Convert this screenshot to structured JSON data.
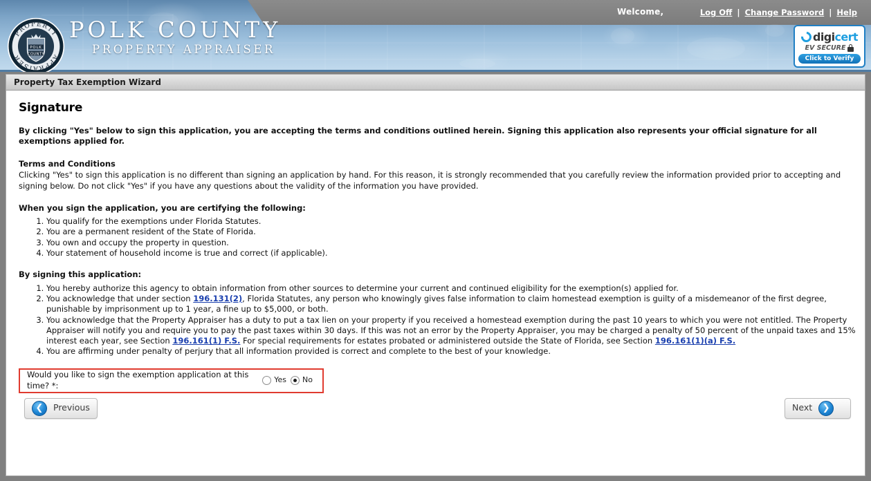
{
  "header": {
    "welcome": "Welcome,",
    "links": [
      {
        "label": "Log Off"
      },
      {
        "label": "Change Password"
      },
      {
        "label": "Help"
      }
    ],
    "separator": "|",
    "logo": {
      "title": "POLK COUNTY",
      "subtitle": "PROPERTY APPRAISER",
      "seal_outer_top": "PROPERTY",
      "seal_outer_bottom": "APPRAISER",
      "seal_shield_line1": "POLK",
      "seal_shield_line2": "COUNTY"
    },
    "digicert": {
      "brand_prefix": "digi",
      "brand_suffix": "cert",
      "tagline": "EV SECURE",
      "verify_label": "Click to Verify"
    }
  },
  "panel": {
    "title": "Property Tax Exemption Wizard"
  },
  "signature": {
    "heading": "Signature",
    "intro": "By clicking \"Yes\" below to sign this application, you are accepting the terms and conditions outlined herein. Signing this application also represents your official signature for all exemptions applied for.",
    "terms_heading": "Terms and Conditions",
    "terms_body": "Clicking \"Yes\" to sign this application is no different than signing an application by hand. For this reason, it is strongly recommended that you carefully review the information provided prior to accepting and signing below. Do not click \"Yes\" if you have any questions about the validity of the information you have provided.",
    "certify_heading": "When you sign the application, you are certifying the following:",
    "certify_items": [
      "You qualify for the exemptions under Florida Statutes.",
      "You are a permanent resident of the State of Florida.",
      "You own and occupy the property in question.",
      "Your statement of household income is true and correct (if applicable)."
    ],
    "signing_heading": "By signing this application:",
    "signing_item_1": "You hereby authorize this agency to obtain information from other sources to determine your current and continued eligibility for the exemption(s) applied for.",
    "signing_item_2_a": "You acknowledge that under section ",
    "signing_item_2_link": "196.131(2)",
    "signing_item_2_b": ", Florida Statutes, any person who knowingly gives false information to claim homestead exemption is guilty of a misdemeanor of the first degree, punishable by imprisonment up to 1 year, a fine up to $5,000, or both.",
    "signing_item_3_a": "You acknowledge that the Property Appraiser has a duty to put a tax lien on your property if you received a homestead exemption during the past 10 years to which you were not entitled. The Property Appraiser will notify you and require you to pay the past taxes within 30 days. If this was not an error by the Property Appraiser, you may be charged a penalty of 50 percent of the unpaid taxes and 15% interest each year, see Section ",
    "signing_item_3_link1": "196.161(1) F.S.",
    "signing_item_3_b": " For special requirements for estates probated or administered outside the State of Florida, see Section ",
    "signing_item_3_link2": "196.161(1)(a) F.S.",
    "signing_item_3_c": "",
    "signing_item_4": "You are affirming under penalty of perjury that all information provided is correct and complete to the best of your knowledge."
  },
  "question": {
    "label": "Would you like to sign the exemption application at this time? *:",
    "options": [
      {
        "label": "Yes",
        "selected": false
      },
      {
        "label": "No",
        "selected": true
      }
    ],
    "border_color": "#e03b2f"
  },
  "nav": {
    "previous_label": "Previous",
    "next_label": "Next",
    "previous_icon": "arrow-left",
    "next_icon": "arrow-right"
  }
}
